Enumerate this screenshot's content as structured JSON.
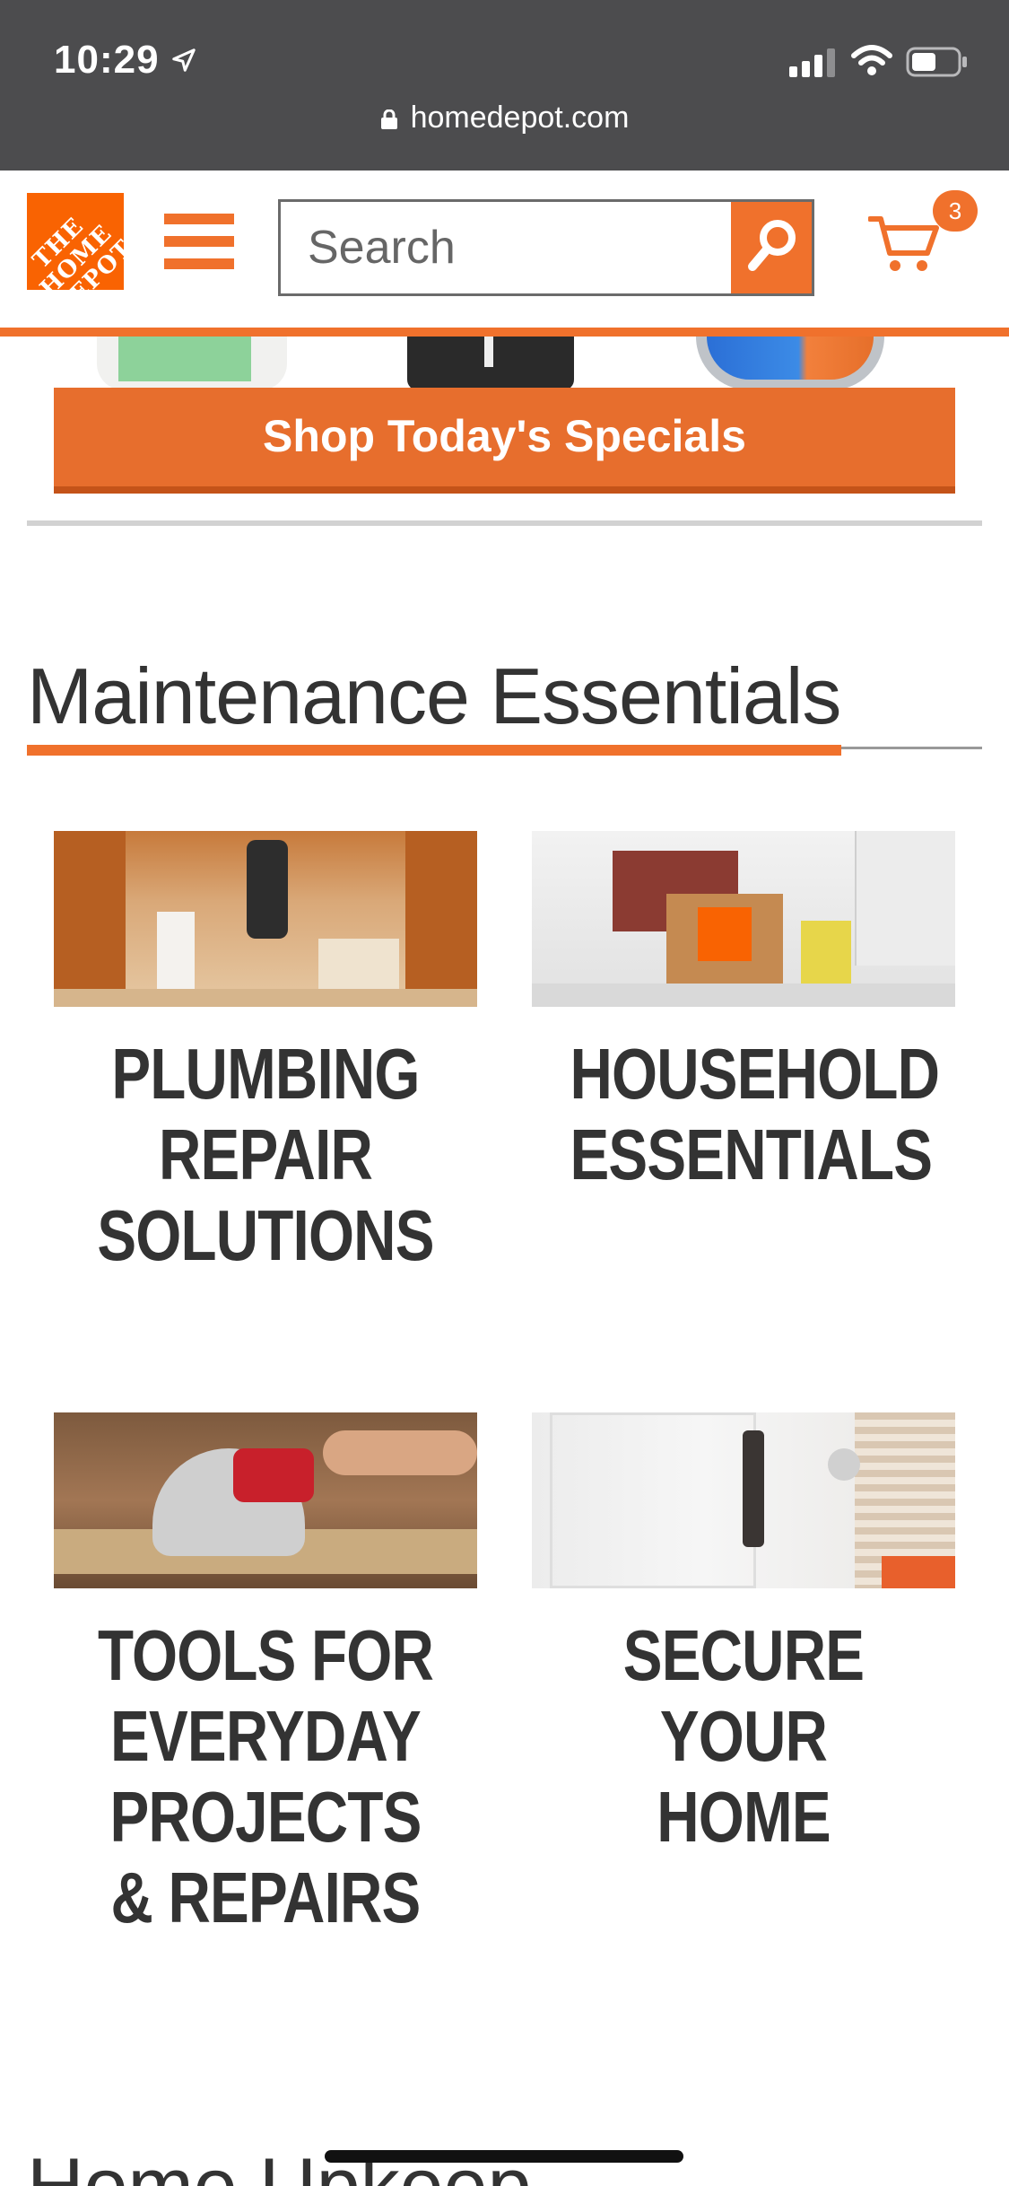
{
  "status_bar": {
    "time": "10:29",
    "url": "homedepot.com"
  },
  "header": {
    "logo_text": "THE HOME DEPOT",
    "search_placeholder": "Search",
    "cart_count": "3"
  },
  "promo": {
    "button_label": "Shop Today's Specials"
  },
  "section": {
    "title": "Maintenance Essentials",
    "cards": [
      {
        "label": "PLUMBING REPAIR SOLUTIONS"
      },
      {
        "label": "HOUSEHOLD ESSENTIALS"
      },
      {
        "label": "TOOLS FOR EVERYDAY PROJECTS & REPAIRS"
      },
      {
        "label": "SECURE YOUR HOME"
      }
    ]
  },
  "next_section": {
    "title": "Home Upkeep"
  },
  "colors": {
    "brand_orange": "#f96302",
    "accent": "#f0712c",
    "status_bar": "#4c4c4e"
  }
}
